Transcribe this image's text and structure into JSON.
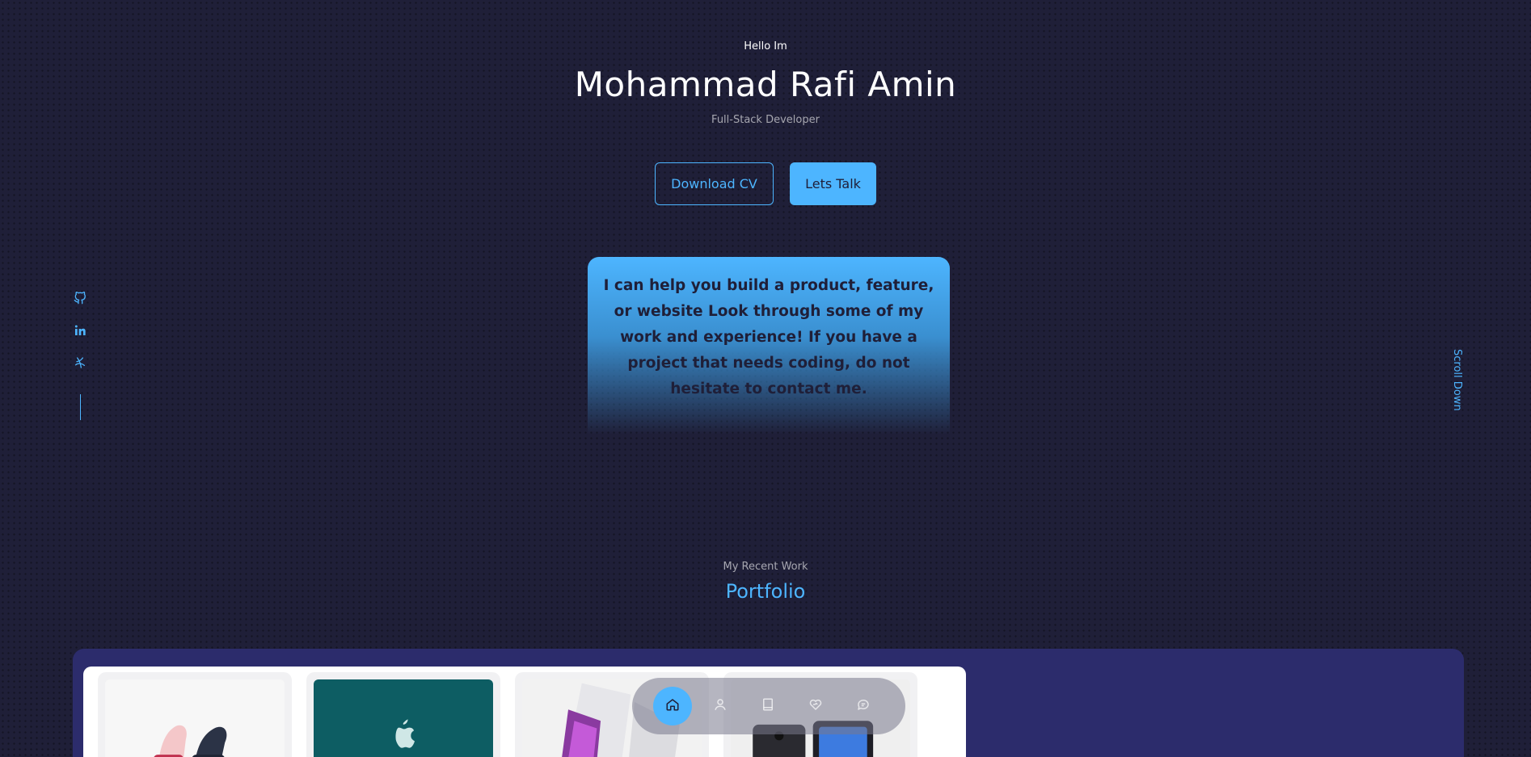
{
  "hero": {
    "greeting": "Hello Im",
    "name": "Mohammad Rafi Amin",
    "role": "Full-Stack Developer",
    "download_cv_label": "Download CV",
    "lets_talk_label": "Lets Talk",
    "intro": "I can help you build a product, feature, or website Look through some of my work and experience! If you have a project that needs coding, do not hesitate to contact me."
  },
  "socials": [
    {
      "icon": "github-icon"
    },
    {
      "icon": "linkedin-icon"
    },
    {
      "icon": "dribbble-icon"
    }
  ],
  "scroll_down_label": "Scroll Down",
  "portfolio": {
    "subtitle": "My Recent Work",
    "title": "Portfolio",
    "items": [
      {
        "image": "watch-bands-image"
      },
      {
        "image": "apple-macbook-image"
      },
      {
        "image": "laptop-image"
      },
      {
        "image": "phone-image"
      }
    ]
  },
  "nav": {
    "items": [
      {
        "icon": "home-icon",
        "active": true
      },
      {
        "icon": "user-icon",
        "active": false
      },
      {
        "icon": "book-icon",
        "active": false
      },
      {
        "icon": "services-icon",
        "active": false
      },
      {
        "icon": "message-icon",
        "active": false
      }
    ]
  },
  "colors": {
    "background": "#1f1f38",
    "primary": "#4db5ff",
    "panel": "#2c2c6c"
  }
}
